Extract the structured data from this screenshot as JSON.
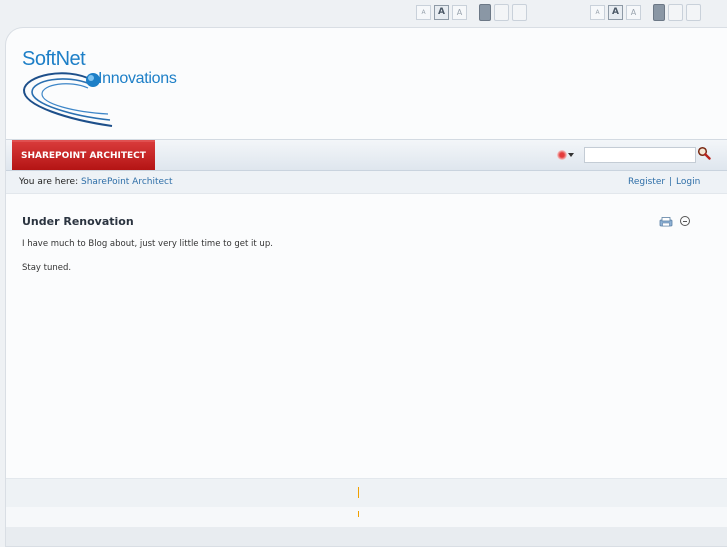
{
  "top_controls": {
    "font_size_small": "A",
    "font_size_medium": "A",
    "font_size_large": "A"
  },
  "logo": {
    "line1": "SoftNet",
    "line2": "Innovations"
  },
  "nav": {
    "tab_label": "SHAREPOINT ARCHITECT"
  },
  "search": {
    "value": "",
    "placeholder": ""
  },
  "breadcrumb": {
    "label": "You are here:",
    "link": "SharePoint Architect"
  },
  "account": {
    "register": "Register",
    "separator": "|",
    "login": "Login"
  },
  "post": {
    "title": "Under Renovation",
    "line1": "I have much to Blog about, just very little time to get it up.",
    "line2": "Stay tuned."
  },
  "colors": {
    "accent_red": "#c31f1f",
    "link_blue": "#2f6fa8",
    "logo_blue": "#1d7fc7"
  }
}
